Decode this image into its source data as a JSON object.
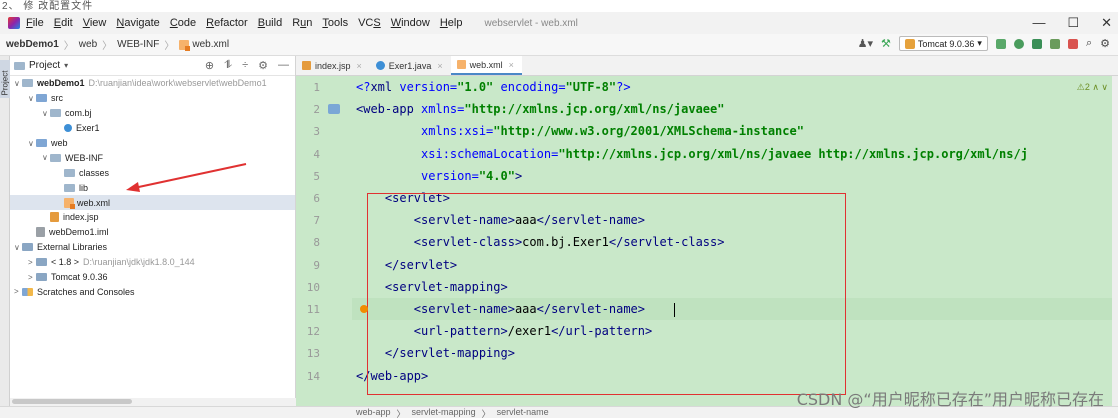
{
  "top_strip_text": "2、 修 改配置文件",
  "menubar": {
    "items": [
      {
        "label": "File",
        "u": "F"
      },
      {
        "label": "Edit",
        "u": "E"
      },
      {
        "label": "View",
        "u": "V"
      },
      {
        "label": "Navigate",
        "u": "N"
      },
      {
        "label": "Code",
        "u": "C"
      },
      {
        "label": "Refactor",
        "u": "R"
      },
      {
        "label": "Build",
        "u": "B"
      },
      {
        "label": "Run",
        "u": "u"
      },
      {
        "label": "Tools",
        "u": "T"
      },
      {
        "label": "VCS",
        "u": "S"
      },
      {
        "label": "Window",
        "u": "W"
      },
      {
        "label": "Help",
        "u": "H"
      }
    ],
    "window_title": "webservlet - web.xml",
    "controls": [
      "—",
      "☐",
      "✕"
    ]
  },
  "navbar": {
    "breadcrumbs": [
      "webDemo1",
      "web",
      "WEB-INF",
      "web.xml"
    ],
    "run_config": "Tomcat 9.0.36"
  },
  "project": {
    "title": "Project",
    "side_label": "1: Project",
    "tree": [
      {
        "label": "webDemo1",
        "path": "D:\\ruanjian\\idea\\work\\webservlet\\webDemo1",
        "indent": 0,
        "arrow": "∨",
        "icon": "folder",
        "bold": true
      },
      {
        "label": "src",
        "indent": 1,
        "arrow": "∨",
        "icon": "folder-blue"
      },
      {
        "label": "com.bj",
        "indent": 2,
        "arrow": "∨",
        "icon": "package"
      },
      {
        "label": "Exer1",
        "indent": 3,
        "arrow": "",
        "icon": "class"
      },
      {
        "label": "web",
        "indent": 1,
        "arrow": "∨",
        "icon": "folder-blue"
      },
      {
        "label": "WEB-INF",
        "indent": 2,
        "arrow": "∨",
        "icon": "folder"
      },
      {
        "label": "classes",
        "indent": 3,
        "arrow": "",
        "icon": "folder"
      },
      {
        "label": "lib",
        "indent": 3,
        "arrow": "",
        "icon": "folder"
      },
      {
        "label": "web.xml",
        "indent": 3,
        "arrow": "",
        "icon": "xml",
        "selected": true
      },
      {
        "label": "index.jsp",
        "indent": 2,
        "arrow": "",
        "icon": "jsp"
      },
      {
        "label": "webDemo1.iml",
        "indent": 1,
        "arrow": "",
        "icon": "iml"
      },
      {
        "label": "External Libraries",
        "indent": 0,
        "arrow": "∨",
        "icon": "lib"
      },
      {
        "label": "< 1.8 >",
        "path": "D:\\ruanjian\\jdk\\jdk1.8.0_144",
        "indent": 1,
        "arrow": ">",
        "icon": "lib"
      },
      {
        "label": "Tomcat 9.0.36",
        "indent": 1,
        "arrow": ">",
        "icon": "lib"
      },
      {
        "label": "Scratches and Consoles",
        "indent": 0,
        "arrow": ">",
        "icon": "scratch"
      }
    ]
  },
  "editor": {
    "tabs": [
      {
        "label": "index.jsp",
        "icon": "jsp",
        "active": false
      },
      {
        "label": "Exer1.java",
        "icon": "class",
        "active": false
      },
      {
        "label": "web.xml",
        "icon": "xml",
        "active": true
      }
    ],
    "inspection": "⚠2 ∧ ∨",
    "lines": [
      "1",
      "2",
      "3",
      "4",
      "5",
      "6",
      "7",
      "8",
      "9",
      "10",
      "11",
      "12",
      "13",
      "14"
    ],
    "code": [
      [
        [
          "p",
          "<?"
        ],
        [
          "t",
          "xml "
        ],
        [
          "a",
          "version="
        ],
        [
          "s",
          "\"1.0\" "
        ],
        [
          "a",
          "encoding="
        ],
        [
          "s",
          "\"UTF-8\""
        ],
        [
          "p",
          "?>"
        ]
      ],
      [
        [
          "t",
          "<web-app "
        ],
        [
          "a",
          "xmlns="
        ],
        [
          "s",
          "\"http://xmlns.jcp.org/xml/ns/javaee\""
        ]
      ],
      [
        [
          "v",
          "         "
        ],
        [
          "a",
          "xmlns:xsi="
        ],
        [
          "s",
          "\"http://www.w3.org/2001/XMLSchema-instance\""
        ]
      ],
      [
        [
          "v",
          "         "
        ],
        [
          "a",
          "xsi:schemaLocation="
        ],
        [
          "s",
          "\"http://xmlns.jcp.org/xml/ns/javaee http://xmlns.jcp.org/xml/ns/j"
        ]
      ],
      [
        [
          "v",
          "         "
        ],
        [
          "a",
          "version="
        ],
        [
          "s",
          "\"4.0\""
        ],
        [
          "t",
          ">"
        ]
      ],
      [
        [
          "v",
          "    "
        ],
        [
          "t",
          "<servlet>"
        ]
      ],
      [
        [
          "v",
          "        "
        ],
        [
          "t",
          "<servlet-name>"
        ],
        [
          "v",
          "aaa"
        ],
        [
          "t",
          "</servlet-name>"
        ]
      ],
      [
        [
          "v",
          "        "
        ],
        [
          "t",
          "<servlet-class>"
        ],
        [
          "v",
          "com.bj.Exer1"
        ],
        [
          "t",
          "</servlet-class>"
        ]
      ],
      [
        [
          "v",
          "    "
        ],
        [
          "t",
          "</servlet>"
        ]
      ],
      [
        [
          "v",
          "    "
        ],
        [
          "t",
          "<servlet-mapping>"
        ]
      ],
      [
        [
          "v",
          "        "
        ],
        [
          "t",
          "<servlet-name>"
        ],
        [
          "v",
          "aaa"
        ],
        [
          "t",
          "</servlet-name>"
        ]
      ],
      [
        [
          "v",
          "        "
        ],
        [
          "t",
          "<url-pattern>"
        ],
        [
          "v",
          "/exer1"
        ],
        [
          "t",
          "</url-pattern>"
        ]
      ],
      [
        [
          "v",
          "    "
        ],
        [
          "t",
          "</servlet-mapping>"
        ]
      ],
      [
        [
          "t",
          "</web-app>"
        ]
      ]
    ]
  },
  "statusbar": {
    "breadcrumbs": [
      "web-app",
      "servlet-mapping",
      "servlet-name"
    ]
  },
  "watermark": "CSDN @“用户昵称已存在”用户昵称已存在",
  "colors": {
    "highlight_green": "#c9e8c9",
    "annotation_red": "#e03131"
  }
}
